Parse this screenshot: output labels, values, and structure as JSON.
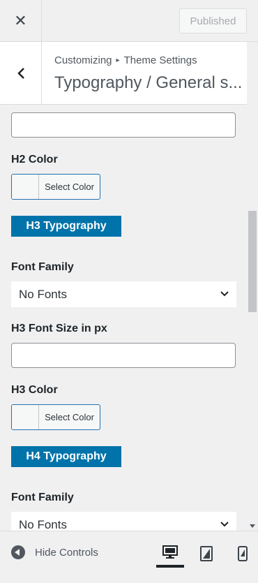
{
  "topbar": {
    "close_icon": "close-icon",
    "publish_label": "Published"
  },
  "header": {
    "breadcrumb_root": "Customizing",
    "breadcrumb_parent": "Theme Settings",
    "title": "Typography / General s..."
  },
  "fields": {
    "h2_color_label": "H2 Color",
    "h2_color_button": "Select Color",
    "h3_heading": "H3 Typography",
    "h3_font_family_label": "Font Family",
    "h3_font_family_value": "No Fonts",
    "h3_font_size_label": "H3 Font Size in px",
    "h3_color_label": "H3 Color",
    "h3_color_button": "Select Color",
    "h4_heading": "H4 Typography",
    "h4_font_family_label": "Font Family",
    "h4_font_family_value": "No Fonts"
  },
  "footer": {
    "hide_controls_label": "Hide Controls",
    "devices": [
      "desktop",
      "tablet",
      "mobile"
    ],
    "active_device": "desktop"
  },
  "colors": {
    "accent": "#2271b1",
    "heading_badge": "#0073aa",
    "background": "#f0f0f1"
  }
}
